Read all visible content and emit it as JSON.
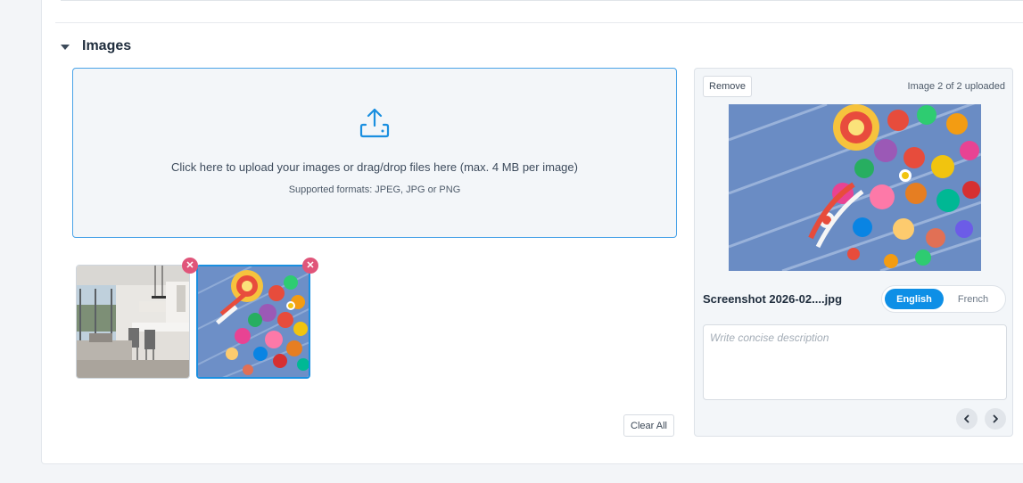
{
  "images_section": {
    "title": "Images",
    "dropzone": {
      "main_text": "Click here to upload your images or drag/drop files here (max. 4 MB per image)",
      "formats_text": "Supported formats: JPEG, JPG or PNG",
      "icon": "upload-icon"
    },
    "thumbnails": [
      {
        "subject": "modern kitchen interior photo",
        "remove_icon": "close-icon",
        "selected": false
      },
      {
        "subject": "colorful candy photo",
        "remove_icon": "close-icon",
        "selected": true
      }
    ],
    "clear_all_label": "Clear All"
  },
  "detail_panel": {
    "remove_label": "Remove",
    "upload_count": "Image 2 of 2 uploaded",
    "filename": "Screenshot 2026-02....jpg",
    "languages": [
      {
        "label": "English",
        "active": true
      },
      {
        "label": "French",
        "active": false
      }
    ],
    "description_placeholder": "Write concise description",
    "description_value": "",
    "prev_icon": "chevron-left-icon",
    "next_icon": "chevron-right-icon"
  },
  "colors": {
    "accent": "#0e8fe6",
    "dropzone_border": "#4aa3e8",
    "remove_badge": "#e0557a",
    "panel_bg": "#f3f6f9"
  }
}
